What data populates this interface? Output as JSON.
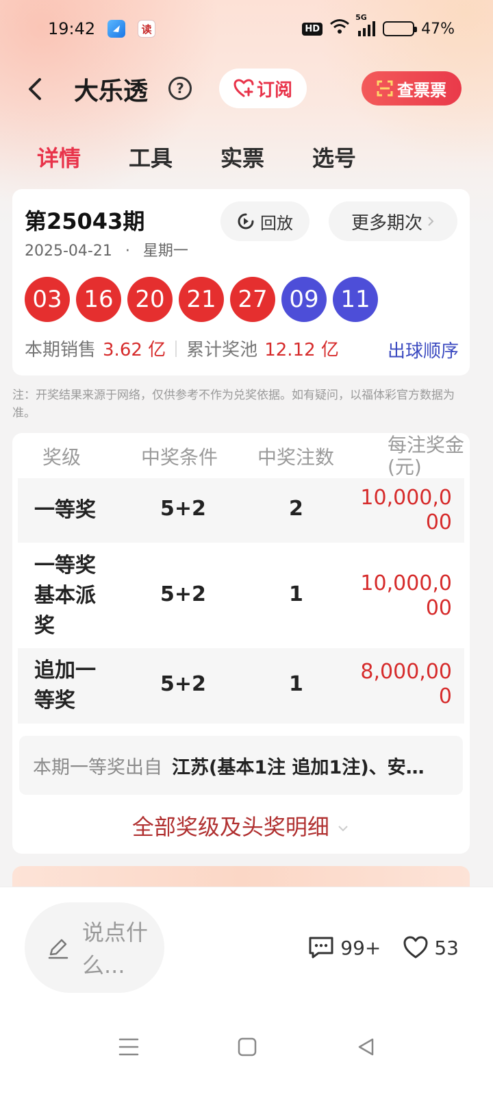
{
  "status_bar": {
    "time": "19:42",
    "app_icons": [
      "browser-app-icon",
      "reader-app-icon"
    ],
    "reader_app_glyph": "读",
    "hd": "HD",
    "network": "5G",
    "battery": "47%",
    "battery_level": 0.47
  },
  "header": {
    "title": "大乐透",
    "help_glyph": "?",
    "subscribe_label": "订阅",
    "check_ticket_label": "查票票"
  },
  "tabs": [
    {
      "label": "详情",
      "active": true
    },
    {
      "label": "工具",
      "active": false
    },
    {
      "label": "实票",
      "active": false
    },
    {
      "label": "选号",
      "active": false
    }
  ],
  "draw": {
    "issue": "第25043期",
    "date": "2025-04-21",
    "dot": "·",
    "weekday": "星期一",
    "replay_label": "回放",
    "more_label": "更多期次",
    "red_balls": [
      "03",
      "16",
      "20",
      "21",
      "27"
    ],
    "blue_balls": [
      "09",
      "11"
    ],
    "sales_label": "本期销售",
    "sales_value": "3.62 亿",
    "pool_label": "累计奖池",
    "pool_value": "12.12 亿",
    "order_label": "出球顺序"
  },
  "note": "注：开奖结果来源于网络，仅供参考不作为兑奖依据。如有疑问，以福体彩官方数据为准。",
  "prize_table": {
    "headers": [
      "奖级",
      "中奖条件",
      "中奖注数",
      "每注奖金(元)"
    ],
    "rows": [
      {
        "level": "一等奖",
        "condition": "5+2",
        "count": "2",
        "amount": "10,000,000"
      },
      {
        "level": "一等奖基本派奖",
        "condition": "5+2",
        "count": "1",
        "amount": "10,000,000"
      },
      {
        "level": "追加一等奖",
        "condition": "5+2",
        "count": "1",
        "amount": "8,000,000"
      }
    ],
    "origin_label": "本期一等奖出自",
    "origin_value": "江苏(基本1注 追加1注)、安…",
    "all_prizes_label": "全部奖级及头奖明细"
  },
  "bottom": {
    "comment_placeholder": "说点什么...",
    "comment_count": "99+",
    "like_count": "53"
  },
  "colors": {
    "accent_red": "#e8334a",
    "ball_red": "#e52f2f",
    "ball_blue": "#4d4ed8",
    "order_blue": "#3b4ac0"
  }
}
